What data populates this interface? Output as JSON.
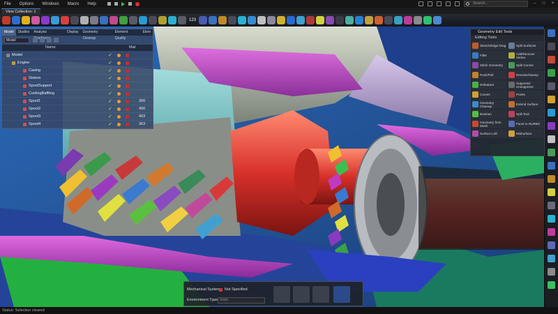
{
  "menu": [
    "File",
    "Options",
    "Windows",
    "Macro",
    "Help"
  ],
  "search": {
    "placeholder": "Search..."
  },
  "window_tab": "View Collection: 1",
  "toolbar": {
    "selection_count": "123"
  },
  "colors": {
    "accent": "#3d7bd6",
    "panel": "#344666",
    "status_bg": "#121212",
    "run_green": "#3cc44a",
    "stop_red": "#e52b2b"
  },
  "tree_panel": {
    "tabs": [
      "Model",
      "Studies",
      "Analysis Readiness",
      "Display",
      "Geometry Cleanup",
      "Element Quality",
      "Elem"
    ],
    "view_select": "Model",
    "header_name": "Name",
    "header_alt": "Mat",
    "rows": [
      {
        "name": "Model",
        "indent": 0,
        "icon": "model-icon",
        "value": ""
      },
      {
        "name": "Engine",
        "indent": 1,
        "icon": "assembly-icon",
        "value": ""
      },
      {
        "name": "Casing",
        "indent": 2,
        "icon": "part-icon",
        "value": ""
      },
      {
        "name": "Stators",
        "indent": 2,
        "icon": "part-icon",
        "value": ""
      },
      {
        "name": "SpoolSupport",
        "indent": 2,
        "icon": "part-icon",
        "value": ""
      },
      {
        "name": "CoolingBaffling",
        "indent": 2,
        "icon": "part-icon",
        "value": ""
      },
      {
        "name": "Spool1",
        "indent": 2,
        "icon": "part-icon",
        "value": "300"
      },
      {
        "name": "Spool2",
        "indent": 2,
        "icon": "part-icon",
        "value": "400"
      },
      {
        "name": "Spool3",
        "indent": 2,
        "icon": "part-icon",
        "value": "403"
      },
      {
        "name": "Spool4",
        "indent": 2,
        "icon": "part-icon",
        "value": "363"
      }
    ]
  },
  "geometry_panel": {
    "title": "Geometry Edit Tools",
    "section": "Editing Tools",
    "tools": [
      {
        "label": "Sketch/Edge Drag",
        "icon": "sketch-icon",
        "color": "#c05a2a"
      },
      {
        "label": "Split Surfaces",
        "icon": "split-surface-icon",
        "color": "#6a7a9a"
      },
      {
        "label": "Fillet",
        "icon": "fillet-icon",
        "color": "#3a7ac8"
      },
      {
        "label": "Add/Remove Vertex",
        "icon": "vertex-icon",
        "color": "#b0b040"
      },
      {
        "label": "Stitch Geometry",
        "icon": "stitch-icon",
        "color": "#8a4aa8"
      },
      {
        "label": "Split Curves",
        "icon": "split-curve-icon",
        "color": "#4a9a5a"
      },
      {
        "label": "Push/Pull",
        "icon": "push-pull-icon",
        "color": "#c8802a"
      },
      {
        "label": "Revolve/Sweep",
        "icon": "revolve-icon",
        "color": "#d04040"
      },
      {
        "label": "Defeature",
        "icon": "defeature-icon",
        "color": "#4ab04a"
      },
      {
        "label": "Suppress/ Unsuppress",
        "icon": "suppress-icon",
        "color": "#6a6a6a"
      },
      {
        "label": "Curves",
        "icon": "curves-icon",
        "color": "#d0a030"
      },
      {
        "label": "Points",
        "icon": "points-icon",
        "color": "#a04040"
      },
      {
        "label": "Geometry Cleanup",
        "icon": "cleanup-icon",
        "color": "#3a8ad0"
      },
      {
        "label": "Extend Surface",
        "icon": "extend-surface-icon",
        "color": "#c07030"
      },
      {
        "label": "Boolean",
        "icon": "boolean-icon",
        "color": "#50c040"
      },
      {
        "label": "Split Tool",
        "icon": "split-tool-icon",
        "color": "#c04060"
      },
      {
        "label": "Geometry from Mesh",
        "icon": "mesh-geometry-icon",
        "color": "#c84a30"
      },
      {
        "label": "Facet to NURBS",
        "icon": "nurbs-icon",
        "color": "#5a6ab8"
      },
      {
        "label": "Surface Loft",
        "icon": "loft-icon",
        "color": "#b04ab0"
      },
      {
        "label": "Midsurface",
        "icon": "midsurface-icon",
        "color": "#d0a040"
      }
    ]
  },
  "mech_dialog": {
    "system_label": "Mechanical System:",
    "system_value": "Not Specified",
    "env_label": "Environment Type:",
    "env_value": "Static"
  },
  "status": {
    "label": "Status:",
    "text": "Selection cleared"
  }
}
